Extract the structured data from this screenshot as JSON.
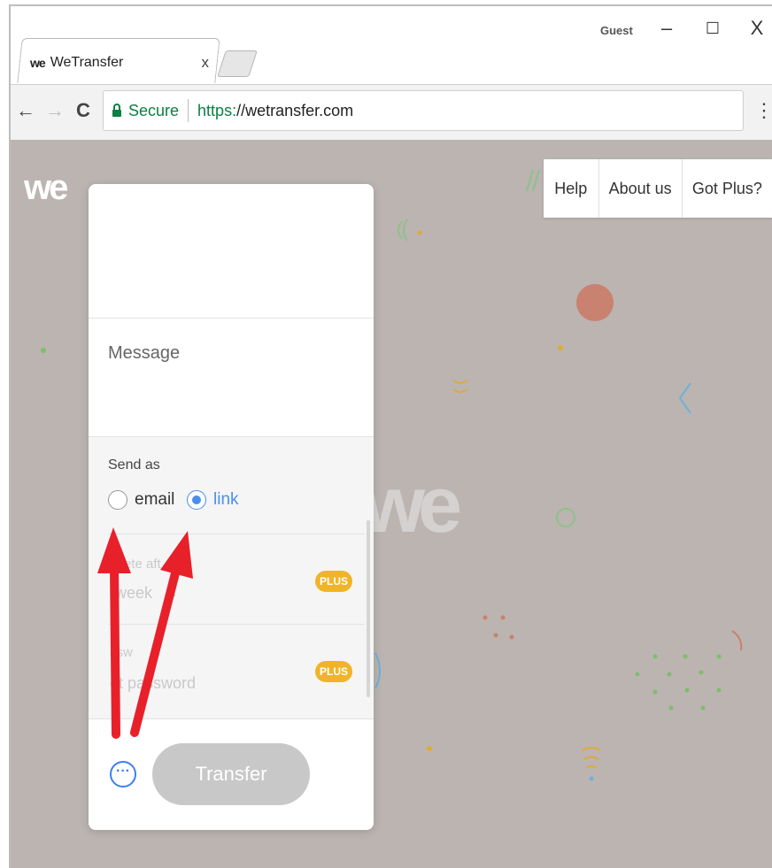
{
  "window": {
    "profile": "Guest",
    "minimize_glyph": "–",
    "maximize_glyph": "☐",
    "close_glyph": "X"
  },
  "tab": {
    "logo": "we",
    "title": "WeTransfer",
    "close_glyph": "x"
  },
  "toolbar": {
    "back_glyph": "←",
    "forward_glyph": "→",
    "reload_glyph": "C",
    "secure_label": "Secure",
    "url_scheme": "https:",
    "url_rest": "//wetransfer.com",
    "menu_glyph": "⋮"
  },
  "page": {
    "logo": "we",
    "ghost_logo": "we",
    "nav": [
      "Help",
      "About us",
      "Got Plus?"
    ]
  },
  "card": {
    "message_placeholder": "Message",
    "send_as_label": "Send as",
    "options": [
      {
        "label": "email",
        "selected": false
      },
      {
        "label": "link",
        "selected": true
      }
    ],
    "expire_label": "ete aft",
    "expire_value": "week",
    "expire_chevron": "⌄",
    "password_label": "ssw",
    "password_placeholder": "et password",
    "plus_badge": "PLUS",
    "more_glyph": "···",
    "transfer_label": "Transfer"
  },
  "colors": {
    "page_bg": "#bbb4b1",
    "accent_blue": "#4a8ef0",
    "plus_badge": "#f0b429",
    "secure_green": "#0b8043",
    "annotation_red": "#e8202a"
  }
}
